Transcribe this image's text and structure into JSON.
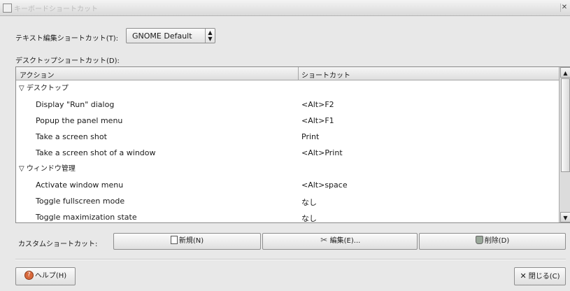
{
  "window": {
    "title": "キーボードショートカット"
  },
  "text_edit": {
    "label": "テキスト編集ショートカット(T):",
    "value": "GNOME Default"
  },
  "desktop_label": "デスクトップショートカット(D):",
  "table": {
    "headers": [
      "アクション",
      "ショートカット"
    ],
    "rows": [
      {
        "type": "category",
        "action": "▽ デスクトップ",
        "shortcut": ""
      },
      {
        "type": "item",
        "action": "Display \"Run\" dialog",
        "shortcut": "<Alt>F2"
      },
      {
        "type": "item",
        "action": "Popup the panel menu",
        "shortcut": "<Alt>F1"
      },
      {
        "type": "item",
        "action": "Take a screen shot",
        "shortcut": "Print"
      },
      {
        "type": "item",
        "action": "Take a screen shot of a window",
        "shortcut": "<Alt>Print"
      },
      {
        "type": "category",
        "action": "▽ ウィンドウ管理",
        "shortcut": ""
      },
      {
        "type": "item",
        "action": "Activate window menu",
        "shortcut": "<Alt>space"
      },
      {
        "type": "item",
        "action": "Toggle fullscreen mode",
        "shortcut": "なし"
      },
      {
        "type": "item",
        "action": "Toggle maximization state",
        "shortcut": "なし"
      }
    ]
  },
  "custom": {
    "label": "カスタムショートカット:",
    "new_label": "新規(N)",
    "edit_label": "編集(E)...",
    "delete_label": "削除(D)"
  },
  "help_label": "ヘルプ(H)",
  "close_label": "閉じる(C)",
  "icons": {
    "window": "window-icon",
    "combo_arrows": "up-down-arrows-icon",
    "new": "new-document-icon",
    "edit": "tools-icon",
    "delete": "trash-icon",
    "help": "help-lifebuoy-icon",
    "close": "close-x-icon"
  }
}
